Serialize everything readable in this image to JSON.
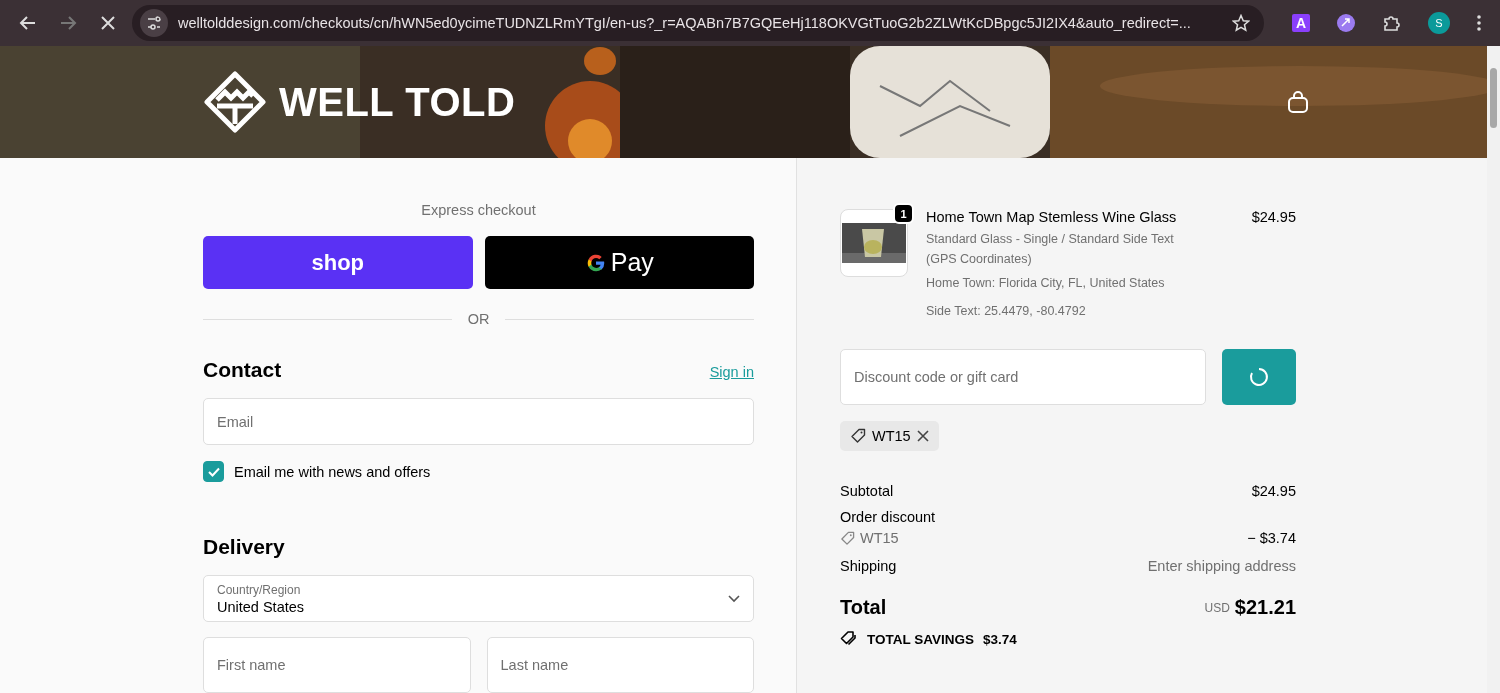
{
  "browser": {
    "url": "welltolddesign.com/checkouts/cn/hWN5ed0ycimeTUDNZLRmYTgI/en-us?_r=AQABn7B7GQEeHj118OKVGtTuoG2b2ZLWtKcDBpgc5JI2IX4&auto_redirect=...",
    "extension_label": "A",
    "profile_initial": "S"
  },
  "header": {
    "brand": "WELL TOLD"
  },
  "express": {
    "title": "Express checkout",
    "shop_label": "shop",
    "gpay_label": "Pay",
    "divider": "OR"
  },
  "contact": {
    "title": "Contact",
    "sign_in": "Sign in",
    "email_placeholder": "Email",
    "newsletter": {
      "label": "Email me with news and offers",
      "checked": true
    }
  },
  "delivery": {
    "title": "Delivery",
    "country_label": "Country/Region",
    "country_value": "United States",
    "first_name_placeholder": "First name",
    "last_name_placeholder": "Last name"
  },
  "cart": {
    "items": [
      {
        "quantity": "1",
        "name": "Home Town Map Stemless Wine Glass",
        "price": "$24.95",
        "variant": "Standard Glass - Single / Standard Side Text (GPS Coordinates)",
        "properties": [
          "Home Town: Florida City, FL, United States",
          "Side Text: 25.4479, -80.4792"
        ]
      }
    ]
  },
  "discount": {
    "placeholder": "Discount code or gift card",
    "applying": true,
    "tags": [
      {
        "code": "WT15"
      }
    ]
  },
  "summary": {
    "subtotal_label": "Subtotal",
    "subtotal": "$24.95",
    "order_discount_label": "Order discount",
    "discount_code": "WT15",
    "discount_amount": "− $3.74",
    "shipping_label": "Shipping",
    "shipping_value": "Enter shipping address",
    "total_label": "Total",
    "currency": "USD",
    "total": "$21.21",
    "savings_label": "TOTAL SAVINGS",
    "savings": "$3.74"
  }
}
